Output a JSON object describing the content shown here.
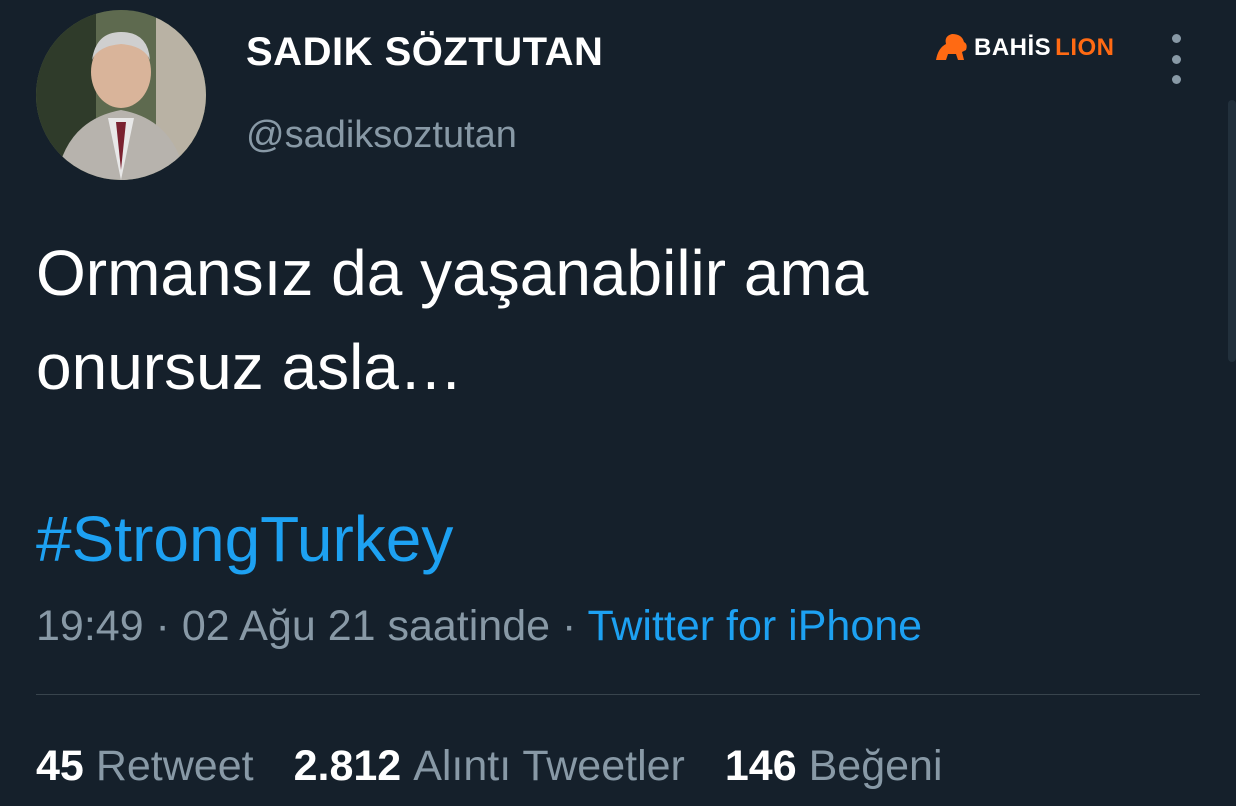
{
  "author": {
    "display_name": "SADIK SÖZTUTAN",
    "handle": "@sadiksoztutan"
  },
  "watermark": {
    "part1": "BAHİS",
    "part2": "LION",
    "accent_color": "#ff6a13"
  },
  "tweet": {
    "line1": "Ormansız da yaşanabilir ama",
    "line2": "onursuz asla…",
    "hashtag": "#StrongTurkey"
  },
  "meta": {
    "time": "19:49",
    "separator": " · ",
    "date": "02 Ağu 21 saatinde",
    "separator2": " · ",
    "source": "Twitter for iPhone"
  },
  "stats": [
    {
      "count": "45",
      "label": "Retweet"
    },
    {
      "count": "2.812",
      "label": "Alıntı Tweetler"
    },
    {
      "count": "146",
      "label": "Beğeni"
    }
  ],
  "colors": {
    "background": "#15202b",
    "link": "#1da1f2",
    "muted": "#8899a6"
  }
}
